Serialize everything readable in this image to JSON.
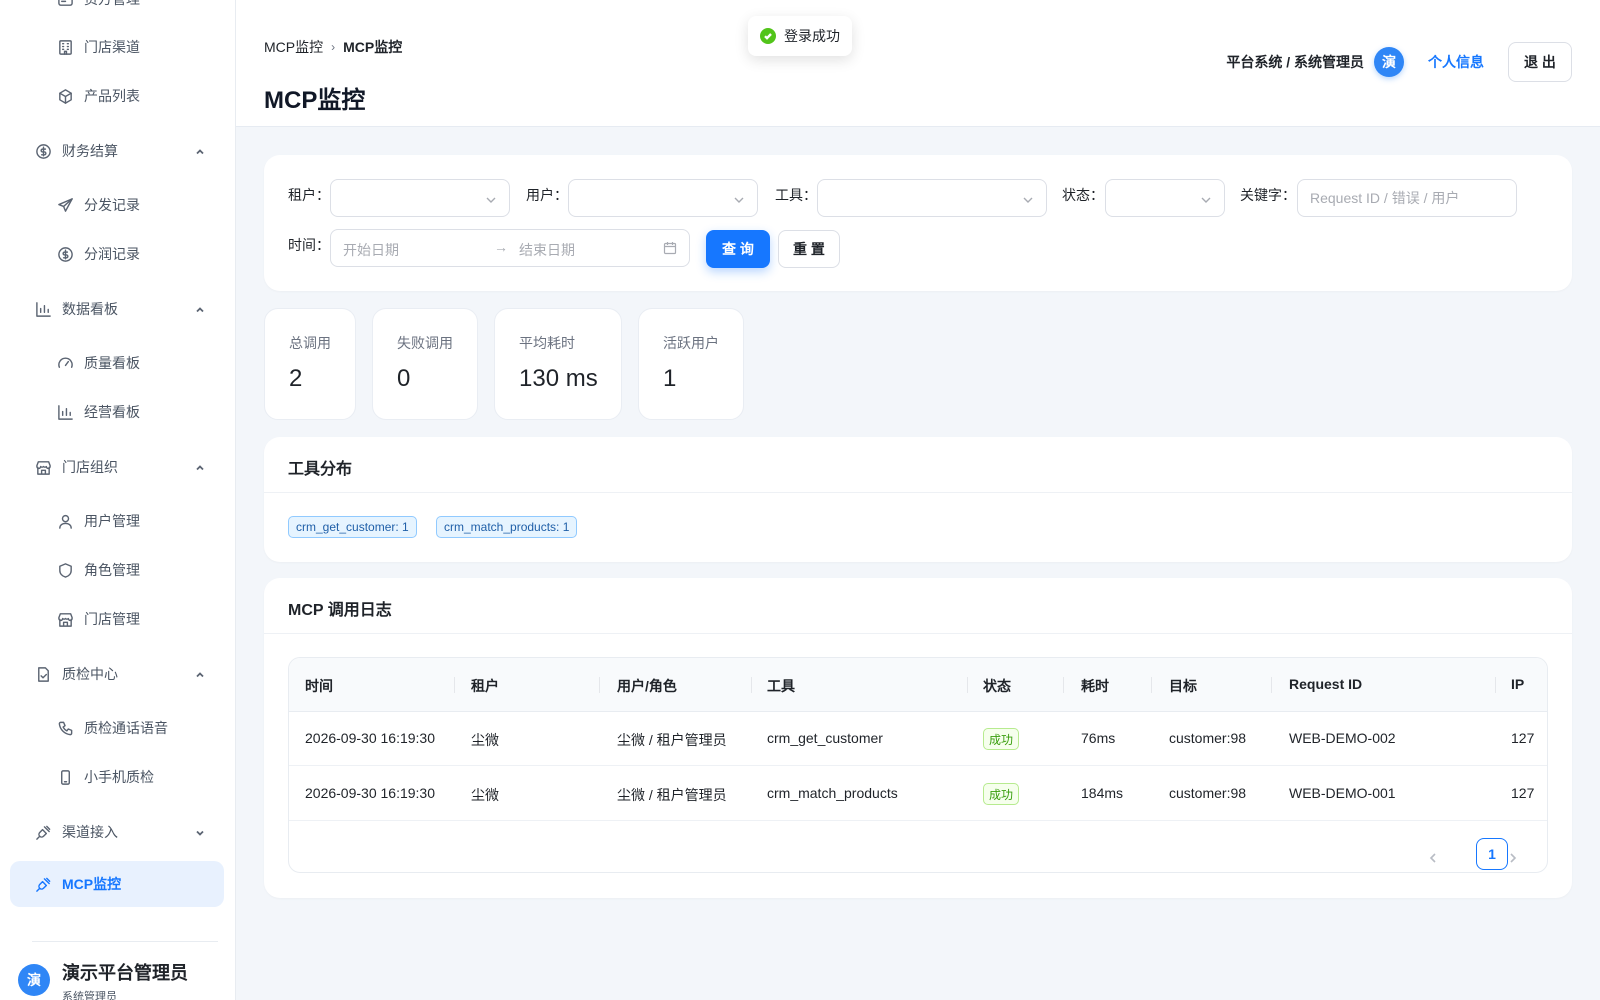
{
  "toast": {
    "message": "登录成功"
  },
  "header": {
    "breadcrumb": [
      "MCP监控",
      "MCP监控"
    ],
    "breadcrumb_sep": "›",
    "title": "MCP监控",
    "system_role": "平台系统 / 系统管理员",
    "avatar_char": "演",
    "profile_link": "个人信息",
    "logout": "退 出"
  },
  "sidebar": {
    "items": [
      {
        "label": "资方管理",
        "icon": "wallet-icon"
      },
      {
        "label": "门店渠道",
        "icon": "building-icon"
      },
      {
        "label": "产品列表",
        "icon": "cube-icon"
      },
      {
        "label": "财务结算",
        "icon": "dollar-icon",
        "expanded": true
      },
      {
        "label": "分发记录",
        "icon": "send-icon"
      },
      {
        "label": "分润记录",
        "icon": "dollar-icon"
      },
      {
        "label": "数据看板",
        "icon": "bar-chart-icon",
        "expanded": true
      },
      {
        "label": "质量看板",
        "icon": "gauge-icon"
      },
      {
        "label": "经营看板",
        "icon": "bar-chart-icon"
      },
      {
        "label": "门店组织",
        "icon": "store-icon",
        "expanded": true
      },
      {
        "label": "用户管理",
        "icon": "user-icon"
      },
      {
        "label": "角色管理",
        "icon": "shield-icon"
      },
      {
        "label": "门店管理",
        "icon": "store-icon"
      },
      {
        "label": "质检中心",
        "icon": "doc-check-icon",
        "expanded": true
      },
      {
        "label": "质检通话语音",
        "icon": "phone-icon"
      },
      {
        "label": "小手机质检",
        "icon": "mobile-icon"
      },
      {
        "label": "渠道接入",
        "icon": "plug-icon",
        "expanded": false
      },
      {
        "label": "MCP监控",
        "icon": "plug-icon",
        "active": true
      }
    ],
    "user": {
      "avatar_char": "演",
      "name": "演示平台管理员",
      "role": "系统管理员"
    }
  },
  "filters": {
    "tenant_label": "租户：",
    "user_label": "用户：",
    "tool_label": "工具：",
    "status_label": "状态：",
    "keyword_label": "关键字：",
    "keyword_placeholder": "Request ID / 错误 / 用户",
    "time_label": "时间：",
    "start_placeholder": "开始日期",
    "end_placeholder": "结束日期",
    "query_button": "查 询",
    "reset_button": "重 置"
  },
  "stats": [
    {
      "label": "总调用",
      "value": "2"
    },
    {
      "label": "失败调用",
      "value": "0"
    },
    {
      "label": "平均耗时",
      "value": "130 ms"
    },
    {
      "label": "活跃用户",
      "value": "1"
    }
  ],
  "tool_distribution": {
    "title": "工具分布",
    "tags": [
      "crm_get_customer: 1",
      "crm_match_products: 1"
    ]
  },
  "logs": {
    "title": "MCP 调用日志",
    "columns": [
      "时间",
      "租户",
      "用户/角色",
      "工具",
      "状态",
      "耗时",
      "目标",
      "Request ID",
      "IP"
    ],
    "rows": [
      [
        "2026-09-30 16:19:30",
        "尘微",
        "尘微 / 租户管理员",
        "crm_get_customer",
        "成功",
        "76ms",
        "customer:98",
        "WEB-DEMO-002",
        "127"
      ],
      [
        "2026-09-30 16:19:30",
        "尘微",
        "尘微 / 租户管理员",
        "crm_match_products",
        "成功",
        "184ms",
        "customer:98",
        "WEB-DEMO-001",
        "127"
      ]
    ],
    "current_page": "1"
  },
  "colors": {
    "primary": "#1677ff",
    "success": "#52c41a",
    "background": "#f3f6fa"
  }
}
